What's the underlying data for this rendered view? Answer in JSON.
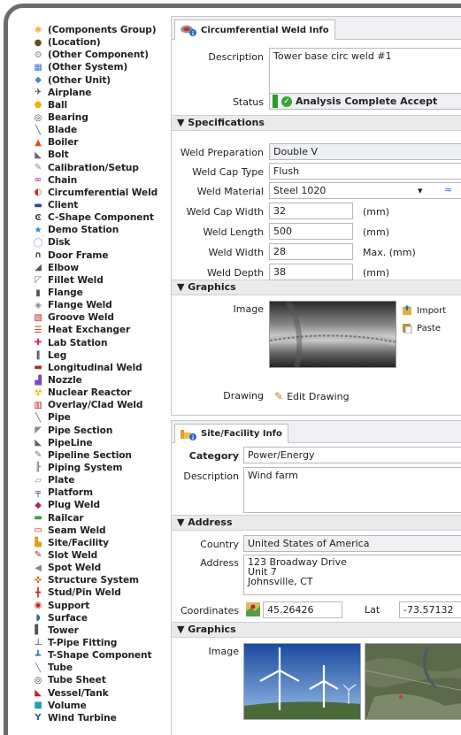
{
  "components": [
    {
      "label": "(Components Group)",
      "icon": "components-group-icon",
      "color": "#e0a020",
      "glyph": "❋"
    },
    {
      "label": "(Location)",
      "icon": "location-icon",
      "color": "#6a4a2a",
      "glyph": "●"
    },
    {
      "label": "(Other Component)",
      "icon": "other-component-icon",
      "color": "#8a8a8a",
      "glyph": "⚙"
    },
    {
      "label": "(Other System)",
      "icon": "other-system-icon",
      "color": "#3a7ac8",
      "glyph": "▦"
    },
    {
      "label": "(Other Unit)",
      "icon": "other-unit-icon",
      "color": "#4a8ac8",
      "glyph": "◆"
    },
    {
      "label": "Airplane",
      "icon": "airplane-icon",
      "color": "#444",
      "glyph": "✈"
    },
    {
      "label": "Ball",
      "icon": "ball-icon",
      "color": "#f0b000",
      "glyph": "●"
    },
    {
      "label": "Bearing",
      "icon": "bearing-icon",
      "color": "#444",
      "glyph": "◎"
    },
    {
      "label": "Blade",
      "icon": "blade-icon",
      "color": "#2a6ab0",
      "glyph": "╲"
    },
    {
      "label": "Boiler",
      "icon": "boiler-icon",
      "color": "#e05010",
      "glyph": "▲"
    },
    {
      "label": "Bolt",
      "icon": "bolt-icon",
      "color": "#666",
      "glyph": "◣"
    },
    {
      "label": "Calibration/Setup",
      "icon": "calibration-icon",
      "color": "#888",
      "glyph": "✎"
    },
    {
      "label": "Chain",
      "icon": "chain-icon",
      "color": "#c040c0",
      "glyph": "∞"
    },
    {
      "label": "Circumferential Weld",
      "icon": "circumferential-weld-icon",
      "color": "#c03030",
      "glyph": "◐"
    },
    {
      "label": "Client",
      "icon": "client-icon",
      "color": "#2a4a8a",
      "glyph": "▬"
    },
    {
      "label": "C-Shape Component",
      "icon": "c-shape-icon",
      "color": "#444",
      "glyph": "Ͼ"
    },
    {
      "label": "Demo Station",
      "icon": "demo-station-icon",
      "color": "#2a8ad0",
      "glyph": "★"
    },
    {
      "label": "Disk",
      "icon": "disk-icon",
      "color": "#a0a0e0",
      "glyph": "◯"
    },
    {
      "label": "Door Frame",
      "icon": "door-frame-icon",
      "color": "#444",
      "glyph": "∩"
    },
    {
      "label": "Elbow",
      "icon": "elbow-icon",
      "color": "#555",
      "glyph": "◢"
    },
    {
      "label": "Fillet Weld",
      "icon": "fillet-weld-icon",
      "color": "#777",
      "glyph": "◸"
    },
    {
      "label": "Flange",
      "icon": "flange-icon",
      "color": "#555",
      "glyph": "▮"
    },
    {
      "label": "Flange Weld",
      "icon": "flange-weld-icon",
      "color": "#888",
      "glyph": "◈"
    },
    {
      "label": "Groove Weld",
      "icon": "groove-weld-icon",
      "color": "#c02020",
      "glyph": "▧"
    },
    {
      "label": "Heat Exchanger",
      "icon": "heat-exchanger-icon",
      "color": "#d04010",
      "glyph": "☰"
    },
    {
      "label": "Lab Station",
      "icon": "lab-station-icon",
      "color": "#e02080",
      "glyph": "✚"
    },
    {
      "label": "Leg",
      "icon": "leg-icon",
      "color": "#333",
      "glyph": "‖"
    },
    {
      "label": "Longitudinal Weld",
      "icon": "longitudinal-weld-icon",
      "color": "#c02020",
      "glyph": "▬"
    },
    {
      "label": "Nozzle",
      "icon": "nozzle-icon",
      "color": "#7a4ac0",
      "glyph": "▟"
    },
    {
      "label": "Nuclear Reactor",
      "icon": "nuclear-reactor-icon",
      "color": "#e0b000",
      "glyph": "☢"
    },
    {
      "label": "Overlay/Clad Weld",
      "icon": "overlay-clad-weld-icon",
      "color": "#c02020",
      "glyph": "▥"
    },
    {
      "label": "Pipe",
      "icon": "pipe-icon",
      "color": "#666",
      "glyph": "╲"
    },
    {
      "label": "Pipe Section",
      "icon": "pipe-section-icon",
      "color": "#888",
      "glyph": "◤"
    },
    {
      "label": "PipeLine",
      "icon": "pipeline-icon",
      "color": "#666",
      "glyph": "◣"
    },
    {
      "label": "Pipeline Section",
      "icon": "pipeline-section-icon",
      "color": "#777",
      "glyph": "✎"
    },
    {
      "label": "Piping System",
      "icon": "piping-system-icon",
      "color": "#666",
      "glyph": "╟"
    },
    {
      "label": "Plate",
      "icon": "plate-icon",
      "color": "#888",
      "glyph": "▱"
    },
    {
      "label": "Platform",
      "icon": "platform-icon",
      "color": "#2a4a8a",
      "glyph": "╤"
    },
    {
      "label": "Plug Weld",
      "icon": "plug-weld-icon",
      "color": "#c02060",
      "glyph": "◆"
    },
    {
      "label": "Railcar",
      "icon": "railcar-icon",
      "color": "#3a9a3a",
      "glyph": "▬"
    },
    {
      "label": "Seam Weld",
      "icon": "seam-weld-icon",
      "color": "#c02020",
      "glyph": "▭"
    },
    {
      "label": "Site/Facility",
      "icon": "site-facility-icon",
      "color": "#e0a020",
      "glyph": "▙"
    },
    {
      "label": "Slot Weld",
      "icon": "slot-weld-icon",
      "color": "#c02020",
      "glyph": "✎"
    },
    {
      "label": "Spot Weld",
      "icon": "spot-weld-icon",
      "color": "#888",
      "glyph": "◀"
    },
    {
      "label": "Structure System",
      "icon": "structure-system-icon",
      "color": "#c06000",
      "glyph": "✜"
    },
    {
      "label": "Stud/Pin Weld",
      "icon": "stud-pin-weld-icon",
      "color": "#c02020",
      "glyph": "╋"
    },
    {
      "label": "Support",
      "icon": "support-icon",
      "color": "#d02020",
      "glyph": "◉"
    },
    {
      "label": "Surface",
      "icon": "surface-icon",
      "color": "#3a6aa0",
      "glyph": "◗"
    },
    {
      "label": "Tower",
      "icon": "tower-icon",
      "color": "#555",
      "glyph": "▌"
    },
    {
      "label": "T-Pipe Fitting",
      "icon": "t-pipe-fitting-icon",
      "color": "#6a6ac0",
      "glyph": "⊥"
    },
    {
      "label": "T-Shape Component",
      "icon": "t-shape-component-icon",
      "color": "#2a6ab0",
      "glyph": "┻"
    },
    {
      "label": "Tube",
      "icon": "tube-icon",
      "color": "#a050c0",
      "glyph": "╲"
    },
    {
      "label": "Tube Sheet",
      "icon": "tube-sheet-icon",
      "color": "#333",
      "glyph": "◎"
    },
    {
      "label": "Vessel/Tank",
      "icon": "vessel-tank-icon",
      "color": "#c02020",
      "glyph": "◣"
    },
    {
      "label": "Volume",
      "icon": "volume-icon",
      "color": "#20a0b0",
      "glyph": "■"
    },
    {
      "label": "Wind Turbine",
      "icon": "wind-turbine-icon",
      "color": "#2a5a9a",
      "glyph": "Y"
    }
  ],
  "weld_panel": {
    "tab_title": "Circumferential Weld Info",
    "description_label": "Description",
    "description_value": "Tower base circ weld #1",
    "status_label": "Status",
    "status_value": "Analysis Complete Accept",
    "status_color": "#2a9b2a",
    "specifications_header": "▼ Specifications",
    "fields": [
      {
        "label": "Weld Preparation",
        "value": "Double V",
        "unit": ""
      },
      {
        "label": "Weld Cap Type",
        "value": "Flush",
        "unit": ""
      },
      {
        "label": "Weld Material",
        "value": "Steel 1020",
        "unit": ""
      },
      {
        "label": "Weld Cap Width",
        "value": "32",
        "unit": "(mm)"
      },
      {
        "label": "Weld Length",
        "value": "500",
        "unit": "(mm)"
      },
      {
        "label": "Weld Width",
        "value": "28",
        "unit": "Max. (mm)"
      },
      {
        "label": "Weld Depth",
        "value": "38",
        "unit": "(mm)"
      }
    ],
    "material_dropdown_glyph": "▾",
    "graphics_header": "▼ Graphics",
    "image_label": "Image",
    "import_label": "Import",
    "paste_label": "Paste",
    "drawing_label": "Drawing",
    "edit_drawing_label": "Edit Drawing"
  },
  "site_panel": {
    "tab_title": "Site/Facility Info",
    "category_label": "Category",
    "category_value": "Power/Energy",
    "description_label": "Description",
    "description_value": "Wind farm",
    "address_header": "▼ Address",
    "country_label": "Country",
    "country_value": "United States of America",
    "address_label": "Address",
    "address_lines": [
      "123 Broadway Drive",
      "Unit 7",
      "Johnsville, CT"
    ],
    "coordinates_label": "Coordinates",
    "coord_value_1": "45.26426",
    "lat_label": "Lat",
    "coord_value_2": "-73.57132",
    "graphics_header": "▼ Graphics",
    "image_label": "Image"
  }
}
